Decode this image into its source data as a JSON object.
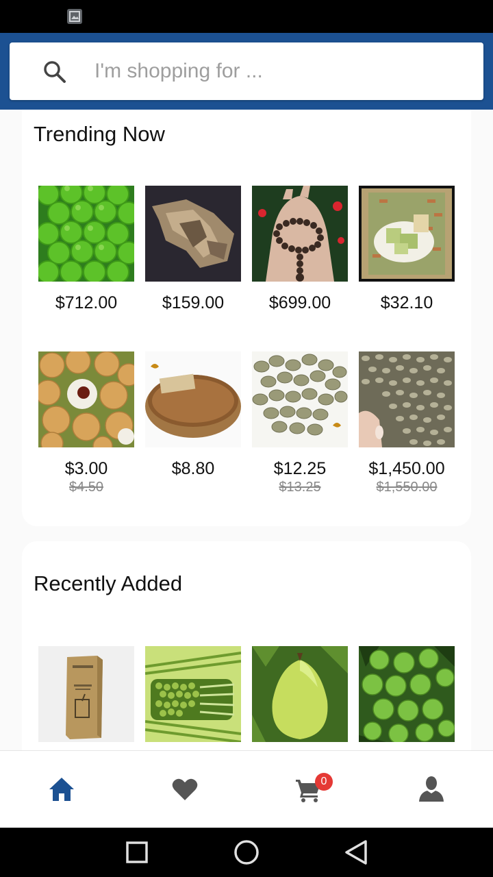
{
  "search": {
    "placeholder": "I'm shopping for ..."
  },
  "sections": {
    "trending": {
      "title": "Trending Now",
      "products": [
        {
          "name": "limes",
          "price": "$712.00",
          "old_price": ""
        },
        {
          "name": "agarwood",
          "price": "$159.00",
          "old_price": ""
        },
        {
          "name": "prayer beads",
          "price": "$699.00",
          "old_price": ""
        },
        {
          "name": "dessert plate",
          "price": "$32.10",
          "old_price": ""
        },
        {
          "name": "longan",
          "price": "$3.00",
          "old_price": "$4.50"
        },
        {
          "name": "robusta coffee basket",
          "price": "$8.80",
          "old_price": ""
        },
        {
          "name": "green coffee beans",
          "price": "$12.25",
          "old_price": "$13.25"
        },
        {
          "name": "raw coffee beans in hand",
          "price": "$1,450.00",
          "old_price": "$1,550.00"
        }
      ]
    },
    "recent": {
      "title": "Recently Added",
      "products": [
        {
          "name": "straw box"
        },
        {
          "name": "grass straws"
        },
        {
          "name": "pomelo"
        },
        {
          "name": "limes on tree"
        }
      ]
    }
  },
  "nav": {
    "items": [
      "home-icon",
      "heart-icon",
      "cart-icon",
      "user-icon"
    ],
    "active": "home",
    "cart_count": "0",
    "active_color": "#1c5192",
    "inactive_color": "#555555"
  },
  "colors": {
    "app_bar": "#1c5192"
  }
}
